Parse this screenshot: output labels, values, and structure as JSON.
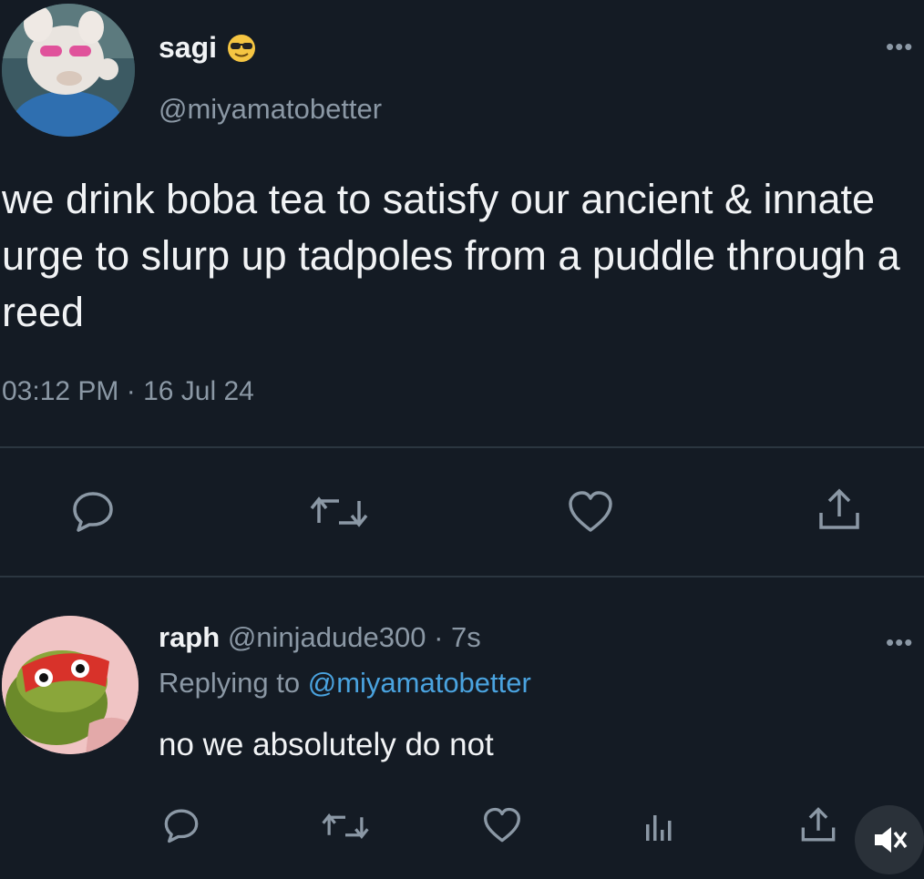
{
  "tweet": {
    "author_name": "sagi",
    "author_emoji_icon": "sunglasses-emoji-icon",
    "author_handle": "@miyamatobetter",
    "text": "we drink boba tea to satisfy our ancient & innate urge to slurp up tadpoles from a puddle through a reed",
    "timestamp": "03:12 PM · 16 Jul 24",
    "actions": [
      "reply-icon",
      "retweet-icon",
      "like-icon",
      "share-icon"
    ]
  },
  "reply": {
    "author_name": "raph",
    "author_handle": "@ninjadude300",
    "time": "· 7s",
    "replying_to_label": "Replying to",
    "replying_to_handle": "@miyamatobetter",
    "text": "no we absolutely do not",
    "actions": [
      "reply-icon",
      "retweet-icon",
      "like-icon",
      "analytics-icon",
      "share-icon"
    ]
  },
  "video_overlay": {
    "mute_icon": "speaker-muted-icon"
  },
  "colors": {
    "background": "#141b24",
    "text_primary": "#f1f3f5",
    "text_secondary": "#8b98a5",
    "link": "#4aa3df",
    "divider": "#2b3640"
  }
}
